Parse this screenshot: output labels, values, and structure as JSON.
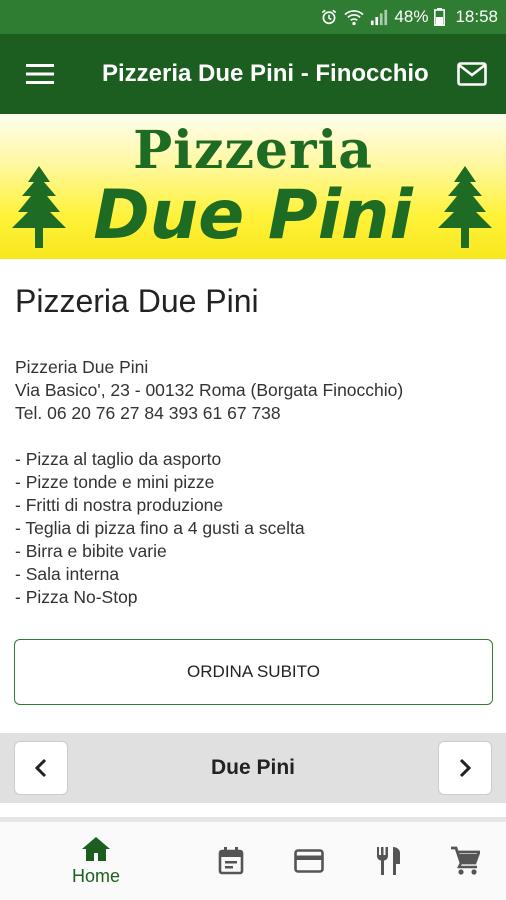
{
  "status_bar": {
    "battery": "48%",
    "time": "18:58",
    "icons": [
      "alarm-icon",
      "wifi-icon",
      "signal-icon",
      "battery-icon"
    ]
  },
  "app_bar": {
    "title": "Pizzeria Due Pini - Finocchio",
    "menu_icon": "hamburger-menu-icon",
    "mail_icon": "mail-icon",
    "color": "#1b5e20"
  },
  "banner": {
    "line1": "Pizzeria",
    "line2": "Due Pini"
  },
  "content": {
    "title": "Pizzeria Due Pini",
    "info_lines": [
      "Pizzeria Due Pini",
      "Via Basico', 23 - 00132 Roma (Borgata Finocchio)",
      "Tel. 06 20 76 27 84  393 61 67 738"
    ],
    "features": [
      "- Pizza al taglio da asporto",
      "- Pizze tonde e mini pizze",
      "- Fritti di nostra produzione",
      "- Teglia di pizza fino a 4 gusti a scelta",
      "- Birra e bibite varie",
      "- Sala interna",
      "- Pizza No-Stop"
    ]
  },
  "order_button": {
    "label": "ORDINA SUBITO"
  },
  "pager": {
    "title": "Due Pini"
  },
  "bottom_nav": {
    "items": [
      {
        "name": "home",
        "label": "Home",
        "icon": "home-icon",
        "active": true
      },
      {
        "name": "calendar",
        "label": "",
        "icon": "calendar-icon",
        "active": false
      },
      {
        "name": "card",
        "label": "",
        "icon": "credit-card-icon",
        "active": false
      },
      {
        "name": "menu",
        "label": "",
        "icon": "restaurant-icon",
        "active": false
      },
      {
        "name": "cart",
        "label": "",
        "icon": "cart-icon",
        "active": false
      }
    ]
  }
}
